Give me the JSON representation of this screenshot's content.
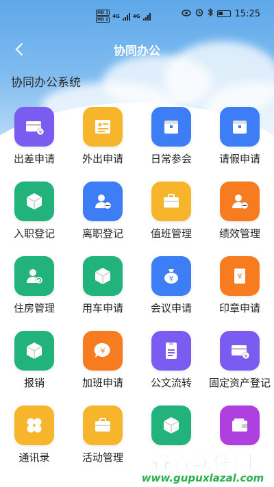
{
  "status_bar": {
    "hd1": "HD 1",
    "hd2": "HD 2",
    "net1": "4G",
    "net2": "4G",
    "time": "15:25"
  },
  "nav": {
    "back_icon": "chevron-left-icon",
    "title": "协同办公"
  },
  "section": {
    "title": "协同办公系统"
  },
  "apps": [
    {
      "label": "出差申请",
      "color": "#7b5cf0",
      "icon": "card-yen-icon"
    },
    {
      "label": "外出申请",
      "color": "#f7b52b",
      "icon": "id-card-icon"
    },
    {
      "label": "日常参会",
      "color": "#3d7df5",
      "icon": "box-calendar-icon"
    },
    {
      "label": "请假申请",
      "color": "#3d7df5",
      "icon": "box-calendar-icon"
    },
    {
      "label": "入职登记",
      "color": "#22b37c",
      "icon": "cube-icon"
    },
    {
      "label": "离职登记",
      "color": "#3d7df5",
      "icon": "user-minus-icon"
    },
    {
      "label": "值班管理",
      "color": "#f7b52b",
      "icon": "briefcase-icon"
    },
    {
      "label": "绩效管理",
      "color": "#f77b1f",
      "icon": "user-minus-icon"
    },
    {
      "label": "住房管理",
      "color": "#22b37c",
      "icon": "user-refresh-icon"
    },
    {
      "label": "用车申请",
      "color": "#22b37c",
      "icon": "cube-icon"
    },
    {
      "label": "会议申请",
      "color": "#3d7df5",
      "icon": "money-bag-icon"
    },
    {
      "label": "印章申请",
      "color": "#f77b1f",
      "icon": "yen-note-icon"
    },
    {
      "label": "报销",
      "color": "#22b37c",
      "icon": "cube-icon"
    },
    {
      "label": "加班申请",
      "color": "#f77b1f",
      "icon": "yen-bubble-icon"
    },
    {
      "label": "公文流转",
      "color": "#7b5cf0",
      "icon": "document-tag-icon"
    },
    {
      "label": "固定资产登记",
      "color": "#7b5cf0",
      "icon": "card-yen-icon"
    },
    {
      "label": "通讯录",
      "color": "#f7b52b",
      "icon": "clover-icon"
    },
    {
      "label": "活动管理",
      "color": "#f7b52b",
      "icon": "briefcase-icon"
    },
    {
      "label": "",
      "color": "#22b37c",
      "icon": "cube-icon"
    },
    {
      "label": "",
      "color": "#b03fe0",
      "icon": "wallet-icon"
    }
  ],
  "watermark": {
    "cn": "谷普软件园",
    "url": "www.gupuxlazal.com"
  }
}
